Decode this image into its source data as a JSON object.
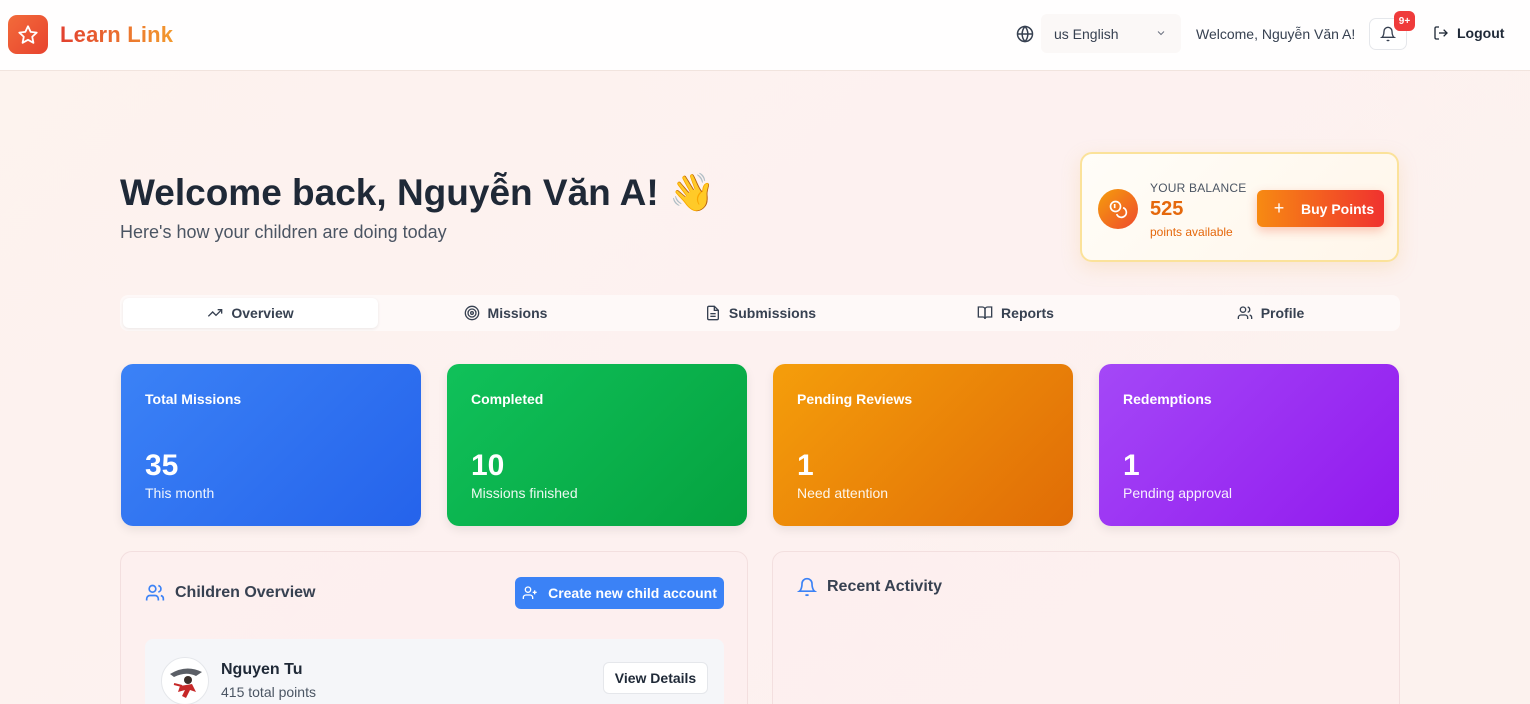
{
  "header": {
    "app_name": "Learn Link",
    "language": "us English",
    "welcome": "Welcome, Nguyễn Văn A!",
    "notification_badge": "9+",
    "logout_label": "Logout"
  },
  "hero": {
    "title": "Welcome back, Nguyễn Văn A! 👋",
    "subtitle": "Here's how your children are doing today"
  },
  "balance": {
    "label": "YOUR BALANCE",
    "value": "525",
    "caption": "points available",
    "buy_label": "Buy Points"
  },
  "tabs": [
    {
      "label": "Overview",
      "icon": "trending-up-icon",
      "active": true
    },
    {
      "label": "Missions",
      "icon": "target-icon"
    },
    {
      "label": "Submissions",
      "icon": "file-text-icon"
    },
    {
      "label": "Reports",
      "icon": "book-open-icon"
    },
    {
      "label": "Profile",
      "icon": "users-icon"
    }
  ],
  "stats": [
    {
      "title": "Total Missions",
      "value": "35",
      "sub": "This month",
      "color": "#3b82f6"
    },
    {
      "title": "Completed",
      "value": "10",
      "sub": "Missions finished",
      "color": "#10c15a"
    },
    {
      "title": "Pending Reviews",
      "value": "1",
      "sub": "Need attention",
      "color": "#f59e0b"
    },
    {
      "title": "Redemptions",
      "value": "1",
      "sub": "Pending approval",
      "color": "#a448f7"
    }
  ],
  "children_panel": {
    "title": "Children Overview",
    "create_label": "Create new child account",
    "children": [
      {
        "name": "Nguyen Tu",
        "points": "415 total points",
        "view_label": "View Details"
      }
    ]
  },
  "activity_panel": {
    "title": "Recent Activity"
  }
}
